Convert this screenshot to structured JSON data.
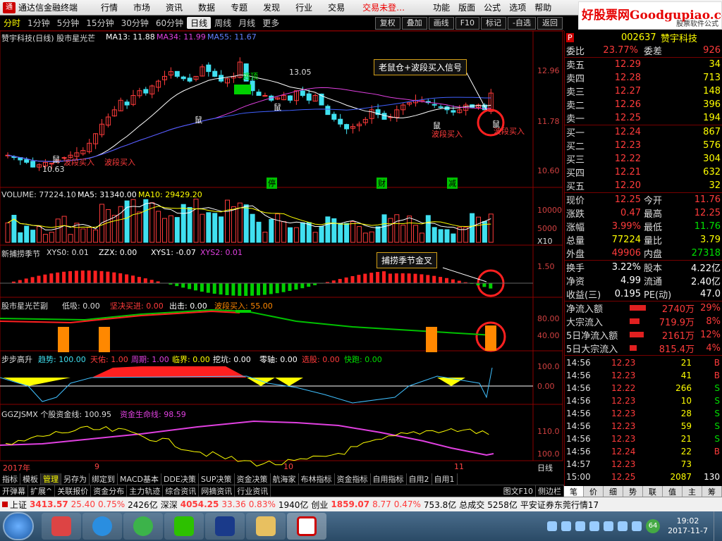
{
  "titlebar": {
    "app": "通达信金融终端",
    "menu": [
      "行情",
      "市场",
      "资讯",
      "数据",
      "专题",
      "发现",
      "行业",
      "交易"
    ],
    "trade": "交易未登…",
    "menu2": [
      "功能",
      "版面",
      "公式",
      "选项",
      "帮助"
    ]
  },
  "watermark": {
    "brand": "好股票网Goodgupiao.com",
    "sub": "股票软件公式"
  },
  "toolbar": {
    "timeframes": [
      "分时",
      "1分钟",
      "5分钟",
      "15分钟",
      "30分钟",
      "60分钟",
      "日线",
      "周线",
      "月线",
      "更多"
    ],
    "active": "日线",
    "buttons": [
      "复权",
      "叠加",
      "画线",
      "F10",
      "标记",
      "-自选",
      "返回"
    ]
  },
  "stock": {
    "code": "002637",
    "name": "赞宇科技"
  },
  "chart": {
    "main_label": "赞宇科技(日线) 股市星光芒",
    "ma13": "MA13: 11.88",
    "ma34": "MA34: 11.99",
    "ma55": "MA55: 11.67",
    "y_ticks_price": [
      "12.96",
      "11.78",
      "10.60"
    ],
    "high_label": "13.05",
    "low_label": "10.63",
    "escape_label": "逃顶",
    "signal_box": "老鼠仓+波段买入信号",
    "buy_label": "波段买入",
    "rat_label": "鼠",
    "markers": [
      "停",
      "财",
      "减"
    ],
    "vol_label": "VOLUME: 77224.10",
    "vol_ma5": "MA5: 31340.00",
    "vol_ma10": "MA10: 29429.20",
    "vol_ticks": [
      "10000",
      "5000"
    ],
    "vol_unit": "X10",
    "ind1_label": "新捕捞季节",
    "ind1_vals": [
      "XYS0: 0.01",
      "ZZX: 0.00",
      "XYS1: -0.07",
      "XYS2: 0.01"
    ],
    "ind1_tick": "1.50",
    "ind1_box": "捕捞季节金叉",
    "ind2_label": "股市星光芒副",
    "ind2_vals": [
      "低吸: 0.00",
      "坚决买进: 0.00",
      "出击: 0.00",
      "波段买入: 55.00"
    ],
    "ind2_ticks": [
      "80.00",
      "40.00"
    ],
    "ind3_label": "步步高升",
    "ind3_vals": [
      "趋势: 100.00",
      "天佑: 1.00",
      "周期: 1.00",
      "临界: 0.00",
      "挖坑: 0.00",
      "零轴: 0.00",
      "选股: 0.00",
      "快跑: 0.00"
    ],
    "ind3_ticks": [
      "100.0",
      "0.00"
    ],
    "ind4_label": "GGZJSMX 个股资金线: 100.95",
    "ind4_val2": "资金生命线: 98.59",
    "ind4_ticks": [
      "110.0",
      "100.0"
    ],
    "x_labels": [
      "2017年",
      "9",
      "10",
      "11"
    ],
    "period": "日线",
    "colors": {
      "up": "#ff3b3b",
      "down": "#40e0f0",
      "ma13": "#ffffff",
      "ma34": "#e040e0",
      "ma55": "#4060ff",
      "yellow": "#ffff00"
    }
  },
  "tabs1": [
    "指标",
    "模板",
    "管理",
    "另存为",
    "绑定到",
    "MACD基本",
    "DDE决策",
    "SUP决策",
    "资金决策",
    "航海家",
    "布林指标",
    "资金指标",
    "自用指标",
    "自用2",
    "自用1"
  ],
  "tabs1_active": "管理",
  "tabs2": [
    "开弹幕",
    "扩展^",
    "关联报价",
    "资金分布",
    "主力轨迹",
    "综合资讯",
    "网摘资讯",
    "行业资讯"
  ],
  "tabs2_right": [
    "图文F10",
    "侧边栏"
  ],
  "quote": {
    "ratio": [
      "委比",
      "23.77%",
      "委差",
      "926"
    ],
    "asks": [
      [
        "卖五",
        "12.29",
        "34"
      ],
      [
        "卖四",
        "12.28",
        "713"
      ],
      [
        "卖三",
        "12.27",
        "148"
      ],
      [
        "卖二",
        "12.26",
        "396"
      ],
      [
        "卖一",
        "12.25",
        "194"
      ]
    ],
    "bids": [
      [
        "买一",
        "12.24",
        "867"
      ],
      [
        "买二",
        "12.23",
        "576"
      ],
      [
        "买三",
        "12.22",
        "304"
      ],
      [
        "买四",
        "12.21",
        "632"
      ],
      [
        "买五",
        "12.20",
        "32"
      ]
    ],
    "stats": [
      [
        "现价",
        "12.25",
        "今开",
        "11.76"
      ],
      [
        "涨跌",
        "0.47",
        "最高",
        "12.25"
      ],
      [
        "涨幅",
        "3.99%",
        "最低",
        "11.76"
      ],
      [
        "总量",
        "77224",
        "量比",
        "3.79"
      ],
      [
        "外盘",
        "49906",
        "内盘",
        "27318"
      ]
    ],
    "fund": [
      [
        "换手",
        "3.22%",
        "股本",
        "4.22亿"
      ],
      [
        "净资",
        "4.99",
        "流通",
        "2.40亿"
      ],
      [
        "收益(三)",
        "0.195",
        "PE(动)",
        "47.0"
      ]
    ],
    "flow": [
      [
        "净流入额",
        "2740万",
        "29%"
      ],
      [
        "大宗流入",
        "719.9万",
        "8%"
      ],
      [
        "5日净流入额",
        "2161万",
        "12%"
      ],
      [
        "5日大宗流入",
        "815.4万",
        "4%"
      ]
    ],
    "ticks": [
      [
        "14:56",
        "12.23",
        "21",
        "B"
      ],
      [
        "14:56",
        "12.23",
        "41",
        "B"
      ],
      [
        "14:56",
        "12.22",
        "266",
        "S"
      ],
      [
        "14:56",
        "12.23",
        "10",
        "S"
      ],
      [
        "14:56",
        "12.23",
        "28",
        "S"
      ],
      [
        "14:56",
        "12.23",
        "59",
        "S"
      ],
      [
        "14:56",
        "12.23",
        "21",
        "S"
      ],
      [
        "14:56",
        "12.24",
        "22",
        "B"
      ],
      [
        "14:57",
        "12.23",
        "73",
        ""
      ],
      [
        "15:00",
        "12.25",
        "2087",
        "130"
      ]
    ],
    "tabs": [
      "笔",
      "价",
      "细",
      "势",
      "联",
      "值",
      "主",
      "筹"
    ]
  },
  "status": {
    "sh": [
      "上证",
      "3413.57",
      "25.40",
      "0.75%",
      "2426亿"
    ],
    "sz": [
      "深深",
      "4054.25",
      "33.36",
      "0.83%",
      "1940亿"
    ],
    "cy": [
      "创业",
      "1859.07",
      "8.77",
      "0.47%",
      "753.8亿"
    ],
    "extra": [
      "总成交",
      "5258亿",
      "平安证券东莞行情17"
    ]
  },
  "taskbar": {
    "time": "19:02",
    "date": "2017-11-7",
    "badge": "64"
  }
}
